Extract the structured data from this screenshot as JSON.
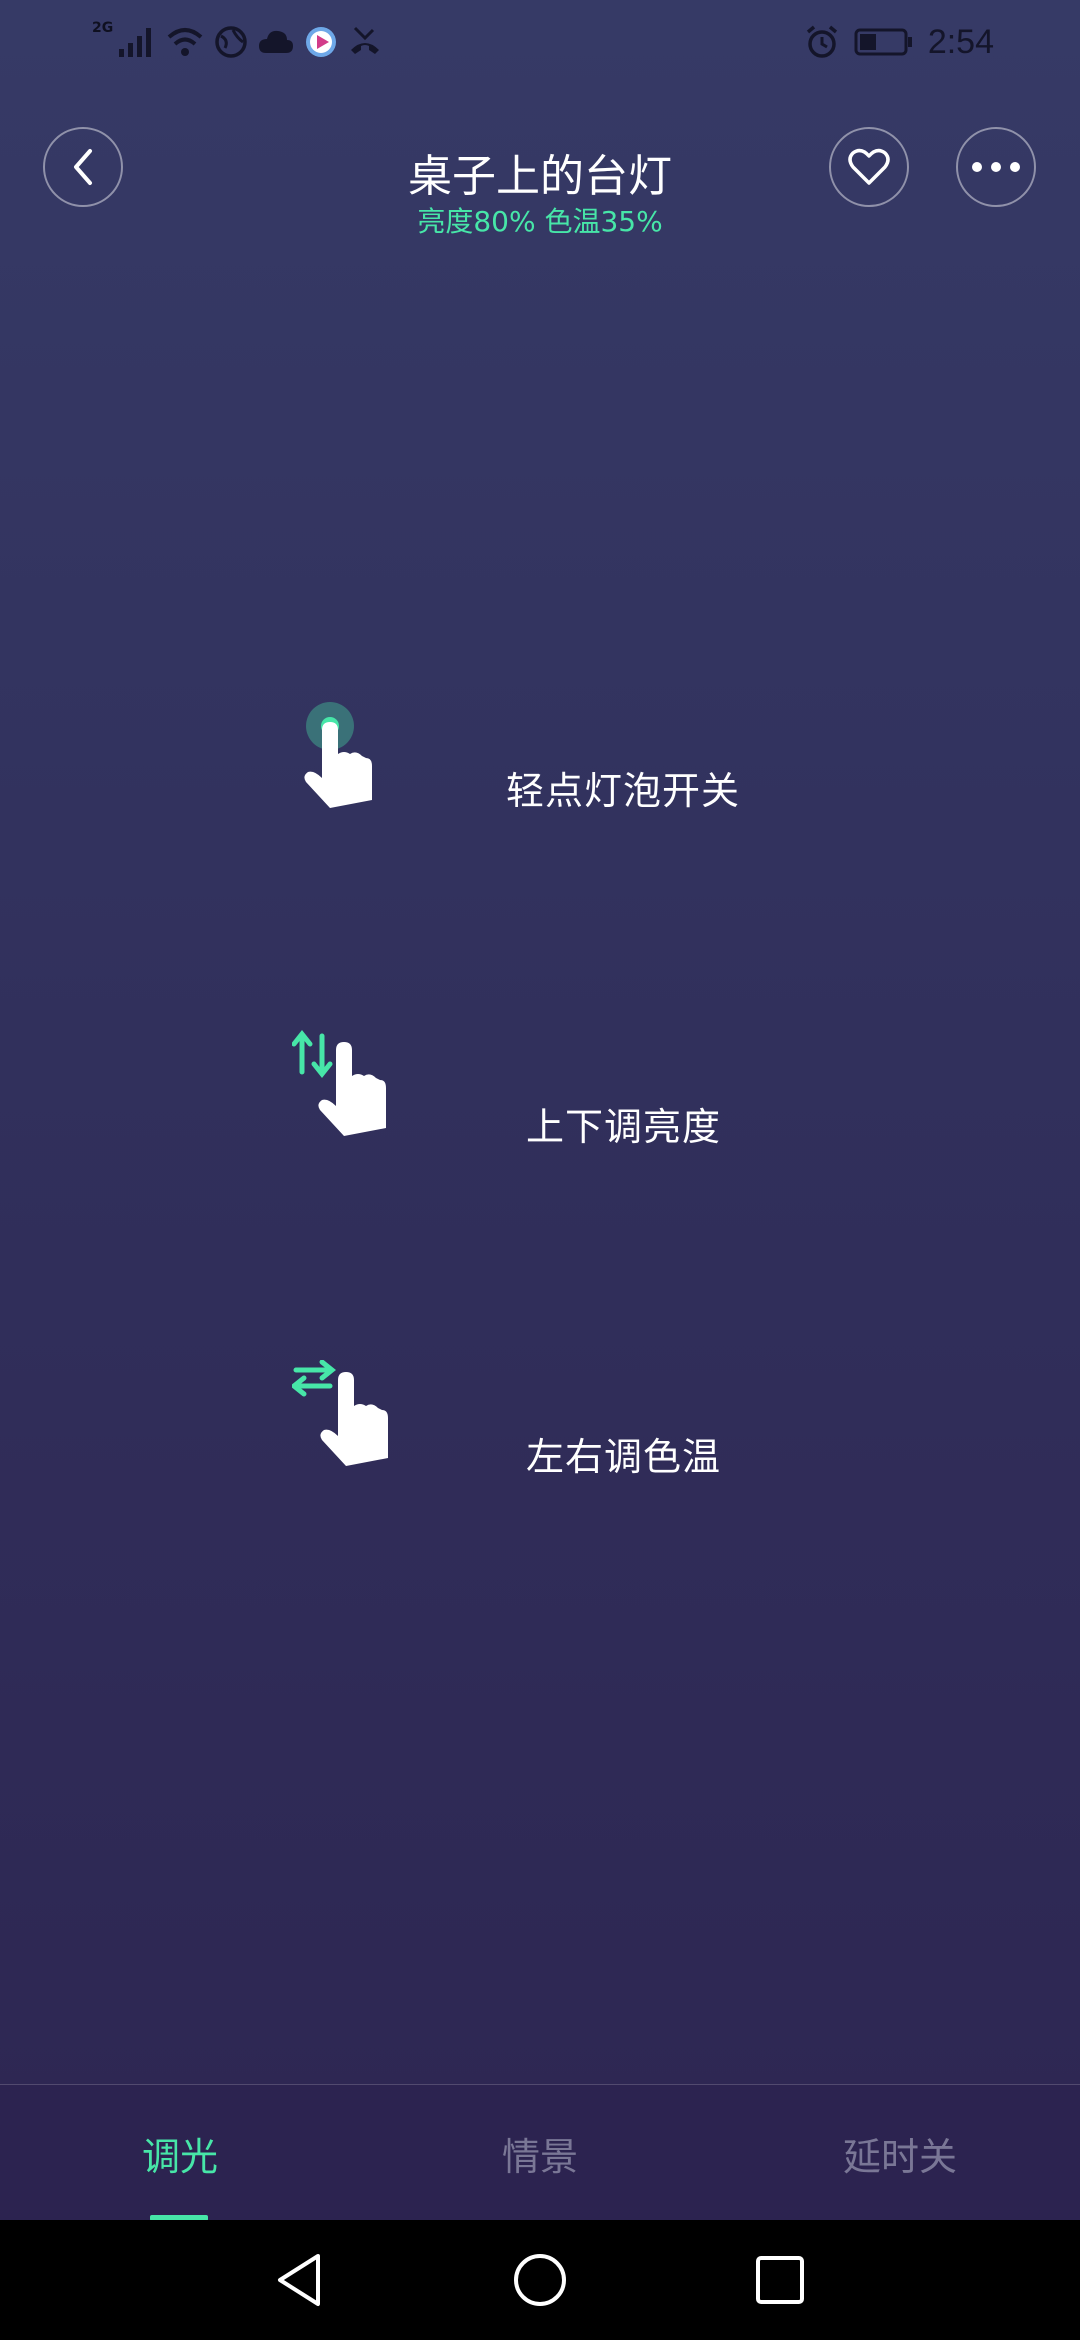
{
  "status_bar": {
    "network_label": "2G",
    "time": "2:54"
  },
  "header": {
    "title": "桌子上的台灯",
    "subtitle": "亮度80% 色温35%"
  },
  "gestures": [
    {
      "label": "轻点灯泡开关",
      "icon": "tap-gesture-icon"
    },
    {
      "label": "上下调亮度",
      "icon": "vertical-swipe-icon"
    },
    {
      "label": "左右调色温",
      "icon": "horizontal-swipe-icon"
    }
  ],
  "tabs": [
    {
      "label": "调光",
      "active": true
    },
    {
      "label": "情景",
      "active": false
    },
    {
      "label": "延时关",
      "active": false
    }
  ],
  "colors": {
    "accent": "#47e6a8",
    "background_top": "#363a66",
    "background_bottom": "#2d2551",
    "tab_inactive": "#7a7796"
  }
}
